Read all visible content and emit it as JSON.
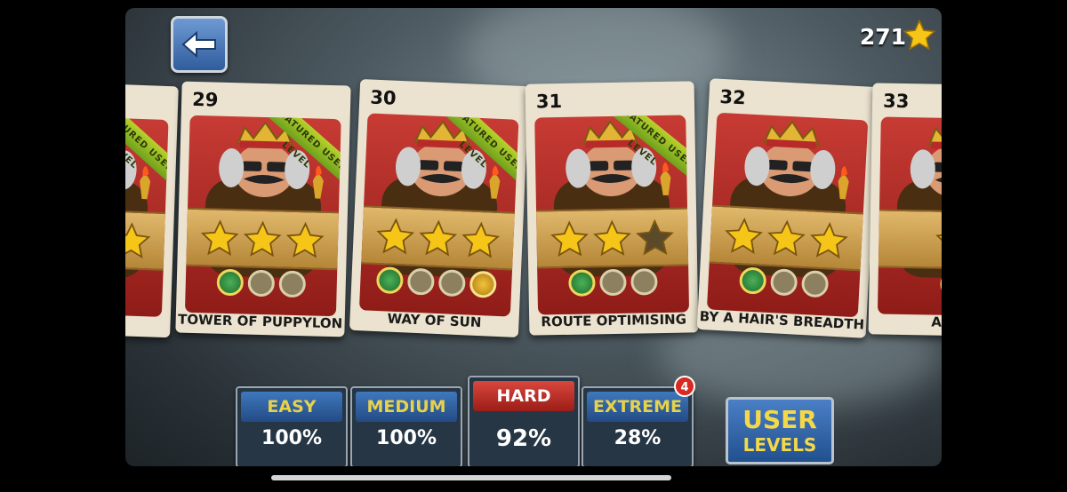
{
  "header": {
    "star_count": "271",
    "back_icon": "arrow-left-icon",
    "star_icon": "star-icon"
  },
  "cards": [
    {
      "number": "",
      "title": "",
      "ribbon": "FEATURED USER LEVEL",
      "stars_earned": 3,
      "stars_total": 3,
      "coins": [
        "empty",
        "empty"
      ]
    },
    {
      "number": "29",
      "title": "TOWER OF PUPPYLON",
      "ribbon": "FEATURED USER LEVEL",
      "stars_earned": 3,
      "stars_total": 3,
      "coins": [
        "green",
        "empty",
        "empty"
      ]
    },
    {
      "number": "30",
      "title": "WAY OF SUN",
      "ribbon": "FEATURED USER LEVEL",
      "stars_earned": 3,
      "stars_total": 3,
      "coins": [
        "green",
        "empty",
        "empty",
        "gold"
      ]
    },
    {
      "number": "31",
      "title": "ROUTE OPTIMISING",
      "ribbon": "FEATURED USER LEVEL",
      "stars_earned": 2,
      "stars_total": 3,
      "coins": [
        "green",
        "empty",
        "empty"
      ]
    },
    {
      "number": "32",
      "title": "BY A HAIR'S BREADTH",
      "ribbon": "",
      "stars_earned": 3,
      "stars_total": 3,
      "coins": [
        "green",
        "empty",
        "empty"
      ]
    },
    {
      "number": "33",
      "title": "A SPA",
      "ribbon": "",
      "stars_earned": 1,
      "stars_total": 1,
      "coins": [
        "green"
      ]
    }
  ],
  "difficulty": [
    {
      "label": "EASY",
      "percent": "100%"
    },
    {
      "label": "MEDIUM",
      "percent": "100%"
    },
    {
      "label": "HARD",
      "percent": "92%"
    },
    {
      "label": "EXTREME",
      "percent": "28%"
    }
  ],
  "extreme_badge": "4",
  "user_levels": {
    "line1": "USER",
    "line2": "LEVELS"
  },
  "colors": {
    "star": "#f5c518",
    "ribbon": "#8fbf2a",
    "hard": "#c0312a",
    "button_blue": "#2f5c9c"
  }
}
